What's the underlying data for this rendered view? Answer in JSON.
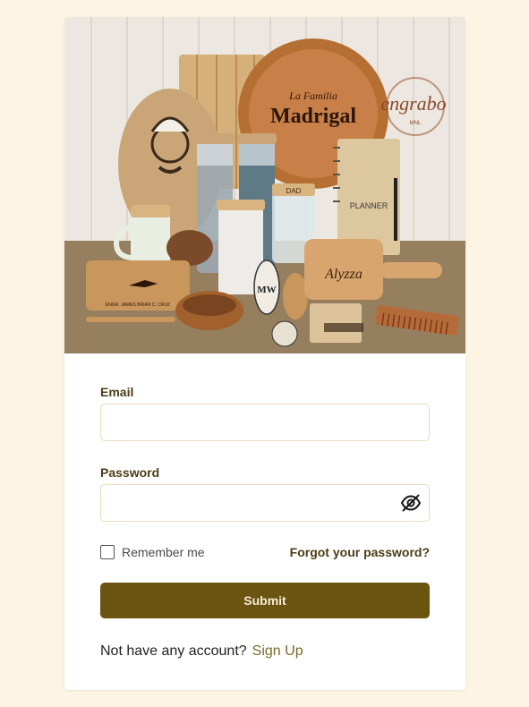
{
  "brand": {
    "logo_text": "engrabo",
    "logo_subtext": "MNL",
    "hero_texts": [
      "La Familia",
      "Madrigal",
      "Alyzza",
      "MW",
      "DAD",
      "PLANNER",
      "ENGR. JAMES BRIAN C. CRUZ",
      "Jones"
    ]
  },
  "form": {
    "email_label": "Email",
    "email_value": "",
    "password_label": "Password",
    "password_value": "",
    "remember_label": "Remember me",
    "remember_checked": false,
    "forgot_label": "Forgot your password?",
    "submit_label": "Submit"
  },
  "footer": {
    "prompt": "Not have any account?",
    "signup_label": "Sign Up"
  },
  "colors": {
    "page_bg": "#fdf4e3",
    "primary": "#6b5410",
    "accent_text": "#4a3d16",
    "link": "#7a6a2a"
  },
  "icons": {
    "password_toggle": "eye-off-icon"
  }
}
